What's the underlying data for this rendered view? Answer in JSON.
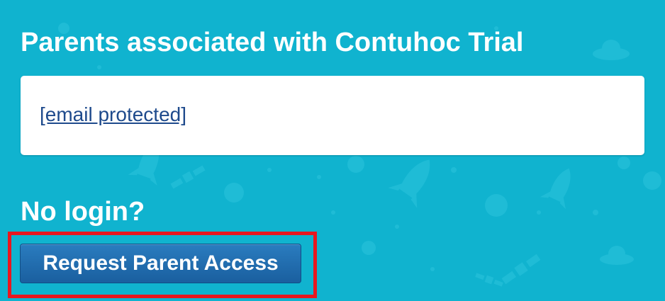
{
  "page": {
    "title": "Parents associated with Contuhoc Trial",
    "background_color": "#10b3cf"
  },
  "parents": {
    "emails": [
      "[email protected]"
    ]
  },
  "access": {
    "heading": "No login?",
    "request_button_label": "Request Parent Access",
    "button_color": "#1f6aa8",
    "highlight_color": "#e8171f"
  }
}
